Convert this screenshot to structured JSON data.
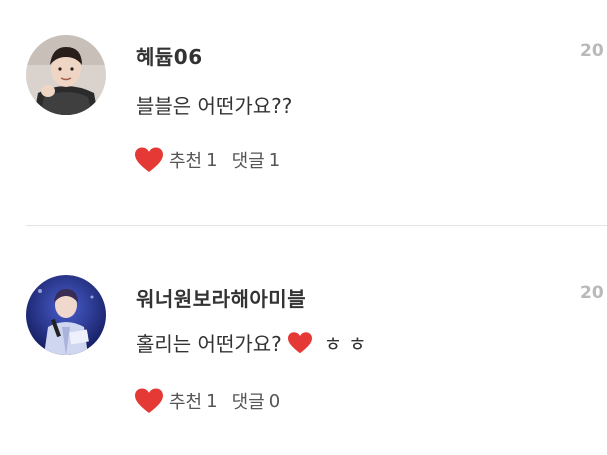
{
  "comments": [
    {
      "author": "혜듑06",
      "date": "20",
      "text": "블블은 어떤가요??",
      "extra": "",
      "like_label": "추천",
      "like_count": "1",
      "reply_label": "댓글",
      "reply_count": "1"
    },
    {
      "author": "워너원보라해아미블",
      "date": "20",
      "text": "홀리는 어떤가요?",
      "extra": "ㅎㅎ",
      "like_label": "추천",
      "like_count": "1",
      "reply_label": "댓글",
      "reply_count": "0"
    }
  ],
  "colors": {
    "heart": "#e53935",
    "date": "#b9b9b9",
    "divider": "#e4e4e4"
  },
  "icons": {
    "like": "heart-icon",
    "inline": "heart-emoji-icon",
    "avatar": "avatar-image"
  }
}
